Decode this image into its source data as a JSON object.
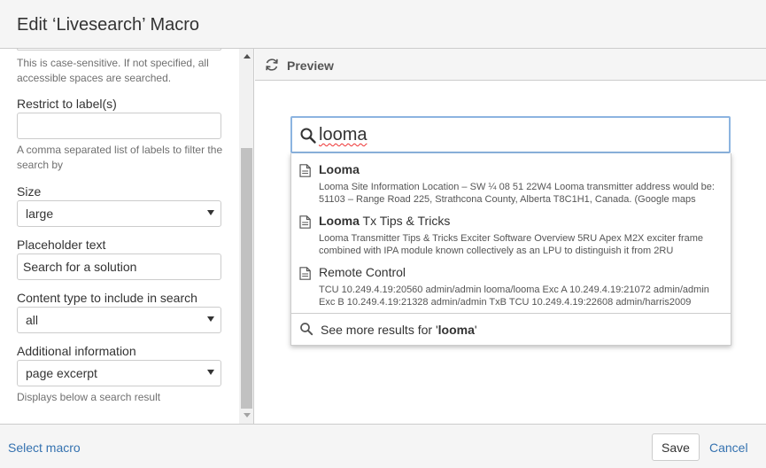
{
  "dialog": {
    "title": "Edit ‘Livesearch’ Macro"
  },
  "form": {
    "spaces_help": "This is case-sensitive. If not specified, all accessible spaces are searched.",
    "labels": {
      "label": "Restrict to label(s)",
      "value": "",
      "help": "A comma separated list of labels to filter the search by"
    },
    "size": {
      "label": "Size",
      "value": "large"
    },
    "placeholder": {
      "label": "Placeholder text",
      "value": "Search for a solution"
    },
    "content_type": {
      "label": "Content type to include in search",
      "value": "all"
    },
    "additional": {
      "label": "Additional information",
      "value": "page excerpt",
      "help": "Displays below a search result"
    }
  },
  "preview": {
    "title": "Preview",
    "search_value": "looma",
    "results": [
      {
        "title_bold": "Looma",
        "title_rest": "",
        "excerpt": "Looma Site Information Location – SW ¼ 08 51 22W4 Looma transmitter address would be: 51103 – Range Road 225, Strathcona County, Alberta T8C1H1, Canada. (Google maps"
      },
      {
        "title_bold": "Looma",
        "title_rest": " Tx Tips & Tricks",
        "excerpt": "Looma Transmitter Tips & Tricks Exciter Software Overview 5RU Apex M2X exciter frame combined with IPA module known collectively as an LPU to distinguish it from 2RU"
      },
      {
        "title_bold": "",
        "title_rest": "Remote Control",
        "excerpt": "TCU 10.249.4.19:20560 admin/admin looma/looma Exc A 10.249.4.19:21072 admin/admin Exc B 10.249.4.19:21328 admin/admin TxB TCU 10.249.4.19:22608 admin/harris2009"
      }
    ],
    "more_prefix": "See more results for '",
    "more_term": "looma",
    "more_suffix": "'"
  },
  "footer": {
    "select_macro": "Select macro",
    "save": "Save",
    "cancel": "Cancel"
  },
  "colors": {
    "link": "#3572b0",
    "search_border": "#8cb4e0",
    "header_bg": "#f5f5f5"
  },
  "icons": {
    "refresh": "refresh-icon",
    "search": "search-icon",
    "document": "document-icon",
    "caret": "chevron-down-icon"
  }
}
